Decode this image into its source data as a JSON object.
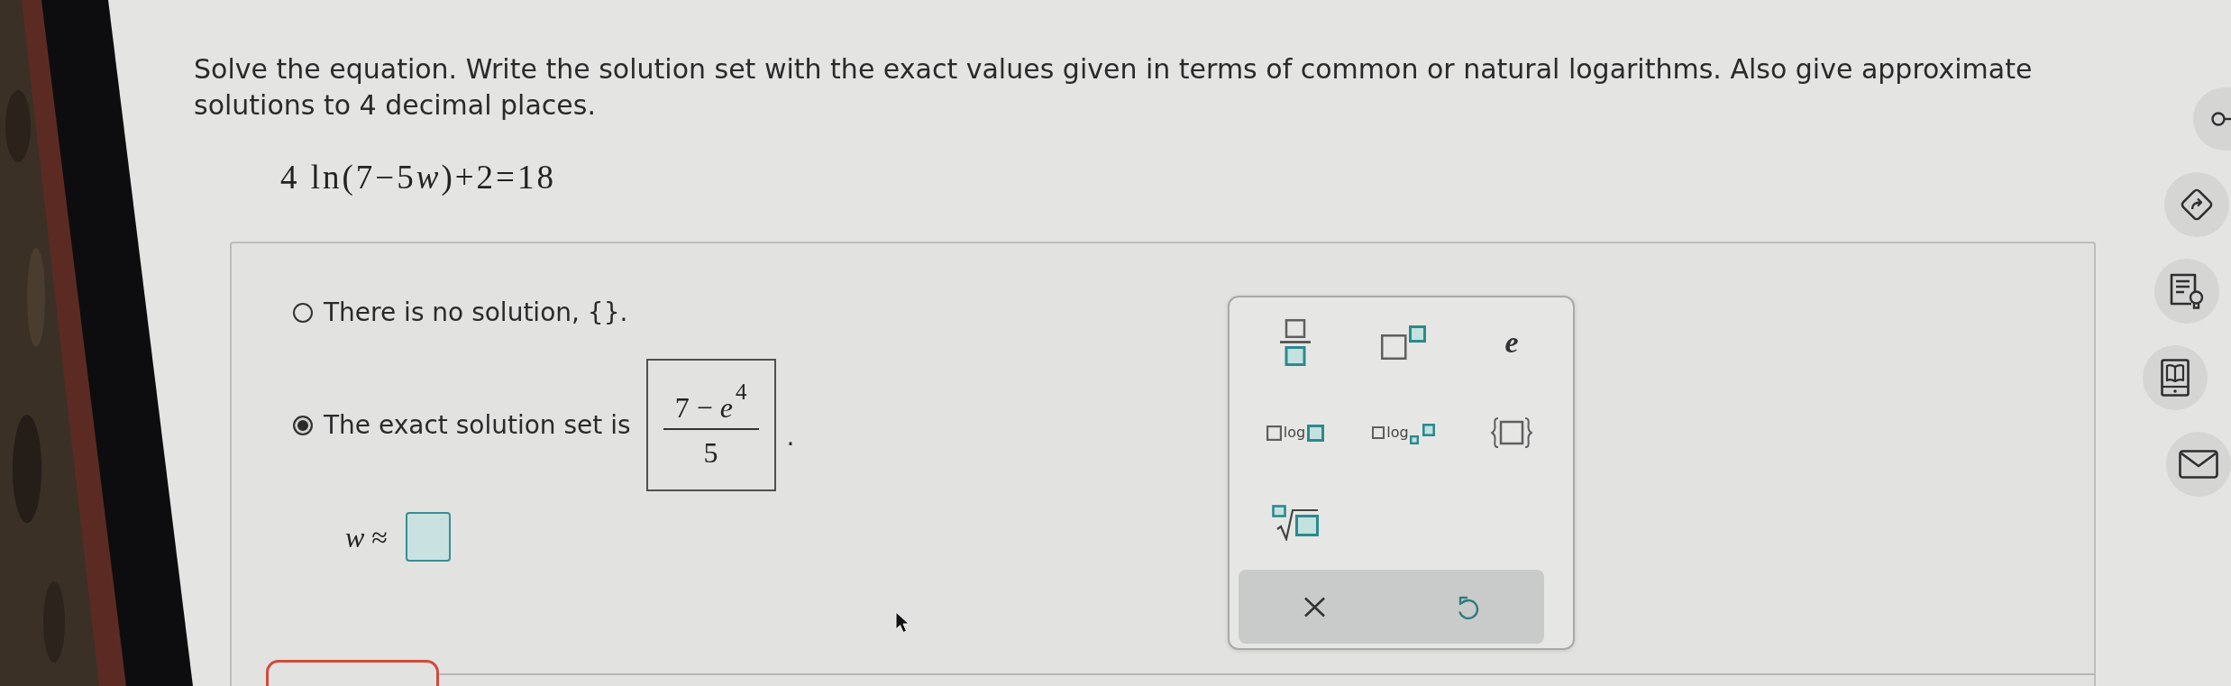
{
  "question": {
    "instruction": "Solve the equation. Write the solution set with the exact values given in terms of common or natural logarithms. Also give approximate solutions to 4 decimal places.",
    "equation": [
      {
        "kind": "plain",
        "text": "4 ln(7−5"
      },
      {
        "kind": "variable",
        "text": "w"
      },
      {
        "kind": "plain",
        "text": ")+2=18"
      }
    ]
  },
  "answer_panel": {
    "options": [
      {
        "label": "There is no solution, {}.",
        "selected": false
      },
      {
        "label": "The exact solution set is",
        "selected": true,
        "answer": {
          "numerator": "7 − *e*$^{4}$",
          "denominator": "5"
        },
        "trailing_text": "."
      }
    ],
    "approximation": {
      "label": "*w* ≈"
    },
    "math_palette": {
      "keys": [
        {
          "kind": "fraction"
        },
        {
          "kind": "power"
        },
        {
          "kind": "constant",
          "label": "e"
        },
        {
          "kind": "log",
          "label": "log"
        },
        {
          "kind": "log-base",
          "label": "log"
        },
        {
          "kind": "braces"
        },
        {
          "kind": "nth-root"
        }
      ],
      "actions": [
        {
          "kind": "clear"
        },
        {
          "kind": "undo"
        }
      ]
    }
  },
  "side_toolbar": [
    {
      "kind": "key"
    },
    {
      "kind": "directions"
    },
    {
      "kind": "notes"
    },
    {
      "kind": "ebook"
    },
    {
      "kind": "mail"
    }
  ]
}
